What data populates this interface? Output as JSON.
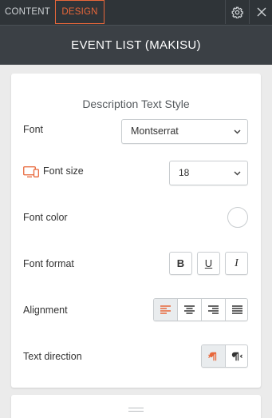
{
  "tabs": {
    "content_label": "CONTENT",
    "design_label": "DESIGN"
  },
  "toolbar": {
    "settings_icon": "gear-icon",
    "close_icon": "close-icon"
  },
  "header": {
    "title": "EVENT LIST (MAKISU)"
  },
  "section": {
    "title": "Description Text Style"
  },
  "font": {
    "label": "Font",
    "value": "Montserrat"
  },
  "font_size": {
    "label": "Font size",
    "value": "18",
    "device_icon": "desktop-mobile-icon"
  },
  "font_color": {
    "label": "Font color",
    "swatch_color": "#ffffff"
  },
  "font_format": {
    "label": "Font format",
    "bold": "B",
    "underline": "U",
    "italic": "I"
  },
  "alignment": {
    "label": "Alignment",
    "options": [
      "align-left-icon",
      "align-center-icon",
      "align-right-icon",
      "align-justify-icon"
    ],
    "selected": "align-left-icon"
  },
  "text_direction": {
    "label": "Text direction",
    "options": [
      "ltr-icon",
      "rtl-icon"
    ],
    "selected": "ltr-icon"
  },
  "colors": {
    "accent": "#e8673a",
    "tabbar_bg": "#2f3438",
    "titlebar_bg": "#3b4045",
    "panel_bg": "#ffffff",
    "page_bg": "#ebebeb"
  }
}
